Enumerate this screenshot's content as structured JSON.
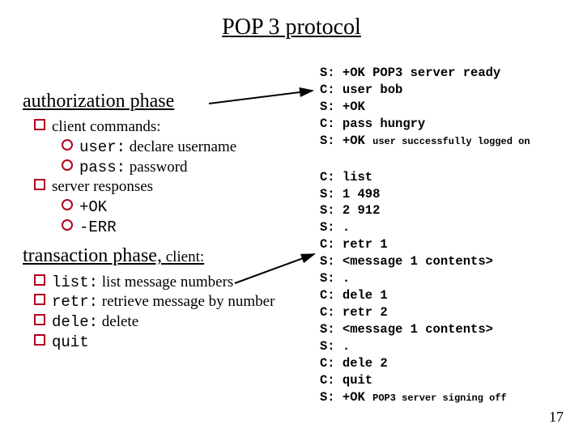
{
  "title": "POP 3 protocol",
  "left": {
    "auth_heading": "authorization phase",
    "client_commands_label": "client commands:",
    "user_cmd": "user:",
    "user_desc": " declare username",
    "pass_cmd": "pass:",
    "pass_desc": " password",
    "server_responses_label": "server responses",
    "ok": "+OK",
    "err": "-ERR",
    "trans_heading": "transaction phase,",
    "trans_heading_tail": " client:",
    "list_cmd": "list:",
    "list_desc": " list message numbers",
    "retr_cmd": "retr:",
    "retr_desc": " retrieve message by number",
    "dele_cmd": "dele:",
    "dele_desc": " delete",
    "quit_cmd": "quit"
  },
  "right": {
    "auth_lines": [
      "S: +OK POP3 server ready",
      "C: user bob",
      "S: +OK",
      "C: pass hungry"
    ],
    "auth_last_prefix": "S: +OK ",
    "auth_last_small": "user successfully logged on",
    "trans_lines": [
      "C: list",
      "S: 1 498",
      "S: 2 912",
      "S: .",
      "C: retr 1",
      "S: <message 1 contents>",
      "S: .",
      "C: dele 1",
      "C: retr 2",
      "S: <message 1 contents>",
      "S: .",
      "C: dele 2",
      "C: quit"
    ],
    "trans_last_prefix": "S: +OK ",
    "trans_last_small": "POP3 server signing off"
  },
  "page_number": "17"
}
